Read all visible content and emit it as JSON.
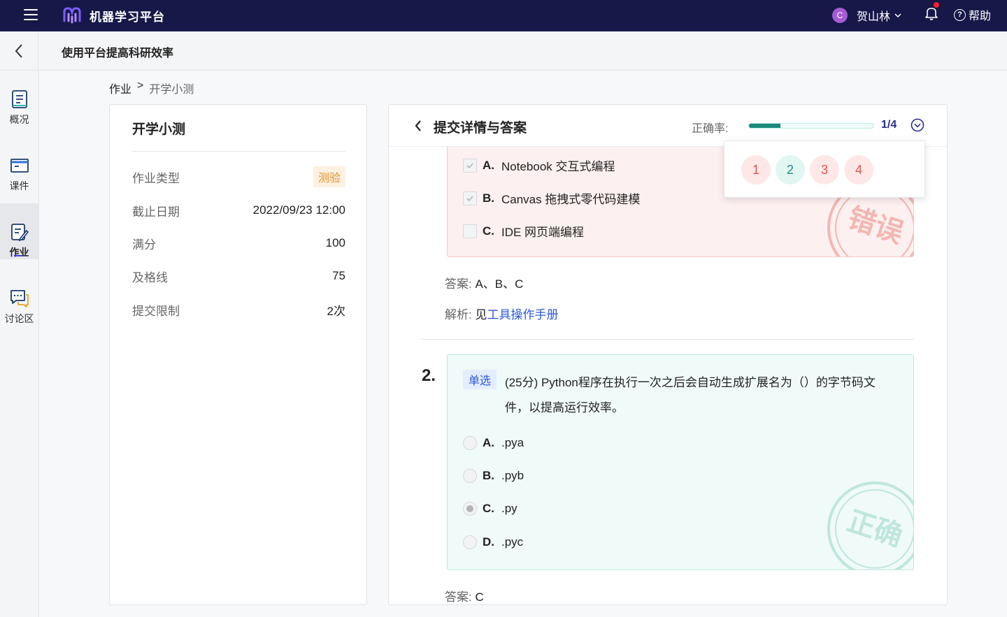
{
  "app": {
    "title": "机器学习平台"
  },
  "user": {
    "initial": "C",
    "name": "贺山林"
  },
  "help": {
    "label": "帮助"
  },
  "course": {
    "title": "使用平台提高科研效率"
  },
  "nav": [
    {
      "label": "概况"
    },
    {
      "label": "课件"
    },
    {
      "label": "作业"
    },
    {
      "label": "讨论区"
    }
  ],
  "breadcrumb": {
    "root": "作业",
    "sep": ">",
    "current": "开学小测"
  },
  "info": {
    "title": "开学小测",
    "rows": [
      {
        "key": "作业类型",
        "value": "测验"
      },
      {
        "key": "截止日期",
        "value": "2022/09/23 12:00"
      },
      {
        "key": "满分",
        "value": "100"
      },
      {
        "key": "及格线",
        "value": "75"
      },
      {
        "key": "提交限制",
        "value": "2次"
      }
    ]
  },
  "panel": {
    "title": "提交详情与答案",
    "accuracy_label": "正确率:",
    "accuracy_value": "1/4",
    "accuracy_fraction": 0.25,
    "progress_color": "#1a8a7a"
  },
  "question_bubbles": [
    {
      "num": "1",
      "status": "wrong"
    },
    {
      "num": "2",
      "status": "right"
    },
    {
      "num": "3",
      "status": "wrong"
    },
    {
      "num": "4",
      "status": "wrong"
    }
  ],
  "q1": {
    "options": [
      {
        "letter": "A.",
        "text": "Notebook 交互式编程",
        "checked": true
      },
      {
        "letter": "B.",
        "text": "Canvas 拖拽式零代码建模",
        "checked": true
      },
      {
        "letter": "C.",
        "text": "IDE 网页端编程",
        "checked": false
      }
    ],
    "stamp": "错误",
    "answer_label": "答案:",
    "answer_value": "A、B、C",
    "analysis_label": "解析:",
    "analysis_prefix": "见",
    "analysis_link": "工具操作手册"
  },
  "q2": {
    "number": "2.",
    "tag": "单选",
    "text": "(25分) Python程序在执行一次之后会自动生成扩展名为（）的字节码文件，以提高运行效率。",
    "options": [
      {
        "letter": "A.",
        "text": ".pya",
        "selected": false
      },
      {
        "letter": "B.",
        "text": ".pyb",
        "selected": false
      },
      {
        "letter": "C.",
        "text": ".py",
        "selected": true
      },
      {
        "letter": "D.",
        "text": ".pyc",
        "selected": false
      }
    ],
    "stamp": "正确",
    "answer_label": "答案:",
    "answer_value": "C"
  },
  "colors": {
    "topbar": "#161848",
    "wrong": "#e5524a",
    "right": "#1b9583",
    "link": "#2c58d8"
  }
}
